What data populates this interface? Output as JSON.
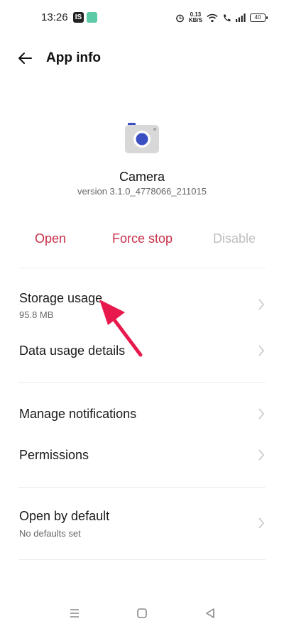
{
  "status_bar": {
    "time": "13:26",
    "badge_is": "IS",
    "net_speed_value": "0.13",
    "net_speed_unit": "KB/S",
    "battery": "40"
  },
  "header": {
    "title": "App info"
  },
  "app": {
    "name": "Camera",
    "version": "version 3.1.0_4778066_211015"
  },
  "actions": {
    "open": "Open",
    "force_stop": "Force stop",
    "disable": "Disable"
  },
  "rows": [
    {
      "title": "Storage usage",
      "subtitle": "95.8 MB"
    },
    {
      "title": "Data usage details"
    },
    {
      "title": "Manage notifications"
    },
    {
      "title": "Permissions"
    },
    {
      "title": "Open by default",
      "subtitle": "No defaults set"
    }
  ],
  "colors": {
    "accent_red": "#c7304a",
    "disabled_gray": "#bdbdbd",
    "annotation_arrow": "#e8194c",
    "camera_lens": "#3a4fc2"
  },
  "icons": {
    "back": "arrow-left-icon",
    "chevron": "chevron-right-icon",
    "app": "camera-app-icon",
    "nav_menu": "recents-icon",
    "nav_home": "home-icon",
    "nav_back": "back-triangle-icon"
  }
}
